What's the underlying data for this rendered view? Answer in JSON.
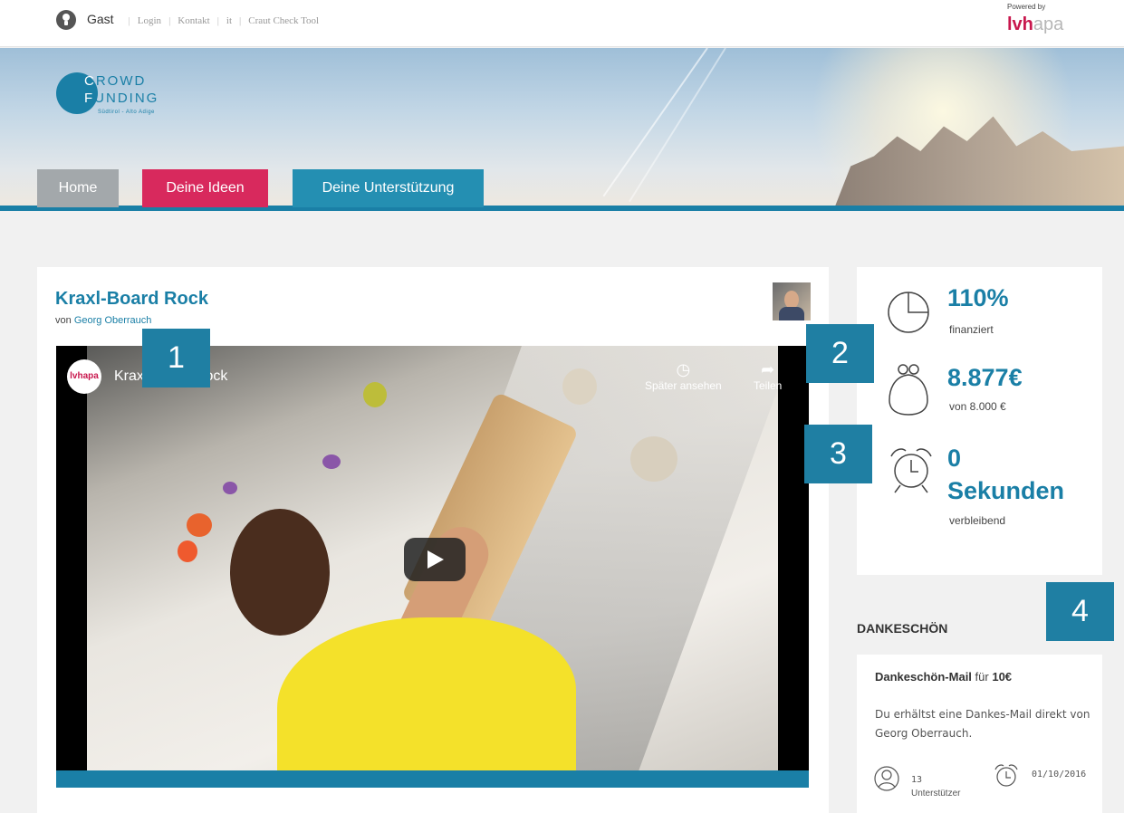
{
  "topbar": {
    "user_name": "Gast",
    "links": [
      "Login",
      "Kontakt",
      "it",
      "Craut Check Tool"
    ],
    "powered_by": "Powered by",
    "sponsor_logo_main": "lvh",
    "sponsor_logo_suffix": "apa"
  },
  "logo": {
    "letter_c": "C",
    "line1_rest": "ROWD",
    "letter_f": "F",
    "line2_rest": "UNDING",
    "subtitle": "Südtirol - Alto Adige"
  },
  "nav": {
    "tabs": [
      "Home",
      "Deine Ideen",
      "Deine Unterstützung"
    ]
  },
  "project": {
    "title": "Kraxl-Board Rock",
    "by_prefix": "von",
    "author": "Georg Oberrauch",
    "video": {
      "channel_logo": "lvhapa",
      "title": "Kraxl-Board Rock",
      "watch_later": "Später ansehen",
      "share": "Teilen"
    }
  },
  "stats": {
    "funded_value": "110%",
    "funded_label": "finanziert",
    "amount_value": "8.877€",
    "amount_goal": "von 8.000 €",
    "time_value": "0",
    "time_unit": "Sekunden",
    "time_label": "verbleibend"
  },
  "rewards": {
    "title": "DANKESCHÖN",
    "items": [
      {
        "name": "Dankeschön-Mail",
        "for_word": "für",
        "price": "10€",
        "description": "Du erhältst eine Dankes-Mail direkt von Georg Oberrauch.",
        "supporters_count": "13",
        "supporters_label": "Unterstützer",
        "date": "01/10/2016"
      }
    ]
  },
  "callouts": [
    "1",
    "2",
    "3",
    "4"
  ],
  "colors": {
    "primary": "#1a7fa6",
    "accent": "#d8295d",
    "tab_home": "#a3a8ab"
  }
}
